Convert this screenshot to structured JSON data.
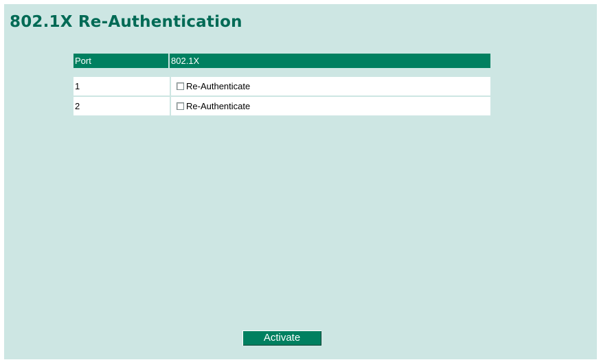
{
  "page": {
    "title": "802.1X Re-Authentication"
  },
  "table": {
    "headers": [
      "Port",
      "802.1X"
    ],
    "rows": [
      {
        "port": "1",
        "checkbox_label": "Re-Authenticate",
        "checked": false
      },
      {
        "port": "2",
        "checkbox_label": "Re-Authenticate",
        "checked": false
      }
    ]
  },
  "actions": {
    "activate_label": "Activate"
  },
  "colors": {
    "accent": "#008060",
    "title": "#006a55",
    "background": "#cde6e3"
  }
}
